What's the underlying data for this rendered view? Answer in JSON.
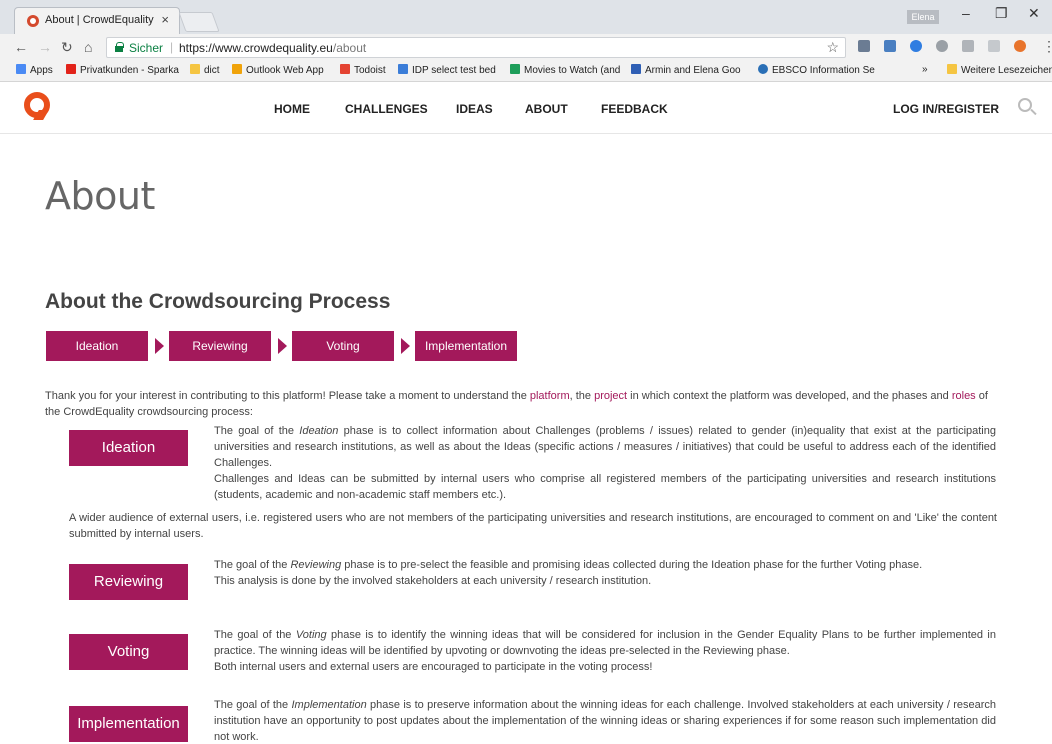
{
  "browser": {
    "tab_title": "About | CrowdEquality",
    "tab_close": "×",
    "profile_label": "Elena",
    "window_controls": [
      "–",
      "❐",
      "✕"
    ],
    "secure_label": "Sicher",
    "url_base": "https://www.crowdequality.eu",
    "url_path": "/about",
    "bookmarks": [
      {
        "label": "Apps",
        "color": "#4a8af4"
      },
      {
        "label": "Privatkunden - Sparka",
        "color": "#e2231a"
      },
      {
        "label": "dict",
        "color": "#f5c542"
      },
      {
        "label": "Outlook Web App",
        "color": "#f0a30a"
      },
      {
        "label": "Todoist",
        "color": "#e44332"
      },
      {
        "label": "IDP select test bed",
        "color": "#3b7dd8"
      },
      {
        "label": "Movies to Watch (and",
        "color": "#1e9e5a"
      },
      {
        "label": "Armin and Elena Goo",
        "color": "#2f5fb5"
      },
      {
        "label": "EBSCO Information Se",
        "color": "#2a6fb6"
      }
    ],
    "bookmarks_overflow": "»",
    "other_bookmarks": "Weitere Lesezeichen"
  },
  "site": {
    "menu": [
      "HOME",
      "CHALLENGES",
      "IDEAS",
      "ABOUT",
      "FEEDBACK"
    ],
    "login": "LOG IN/REGISTER",
    "accent": "#a3195b",
    "logo_color": "#e94e1b"
  },
  "content": {
    "page_title": "About",
    "section_title": "About the Crowdsourcing Process",
    "steps": [
      "Ideation",
      "Reviewing",
      "Voting",
      "Implementation"
    ],
    "intro_1": "Thank you for your interest in contributing to this platform! Please take a moment to understand the ",
    "intro_link_platform": "platform",
    "intro_2": ", the ",
    "intro_link_project": "project",
    "intro_3": " in which context the platform was developed, and the phases and ",
    "intro_link_roles": "roles",
    "intro_4": " of the CrowdEquality crowdsourcing process:",
    "phases": {
      "ideation": {
        "button": "Ideation",
        "p1_a": "The goal of the ",
        "p1_em": "Ideation",
        "p1_b": " phase is to collect information about Challenges (problems / issues) related to gender (in)equality that exist at the participating universities and research institutions, as well as about the Ideas (specific actions / measures / initiatives) that could be useful to address each of the identified Challenges.",
        "p2": "Challenges and Ideas can be submitted by internal users who comprise all registered members of the participating universities and research institutions (students, academic and non-academic staff members etc.).",
        "p3": "A wider audience of external users, i.e. registered users who are not members of the participating universities and research institutions, are encouraged to comment on and 'Like' the content submitted by internal users."
      },
      "reviewing": {
        "button": "Reviewing",
        "p1_a": "The goal of the ",
        "p1_em": "Reviewing",
        "p1_b": " phase is to pre-select the feasible and promising ideas collected during the Ideation phase for the further Voting phase.",
        "p2": "This analysis is done by the involved stakeholders at each university / research institution."
      },
      "voting": {
        "button": "Voting",
        "p1_a": "The goal of the ",
        "p1_em": "Voting",
        "p1_b": " phase is to identify the winning ideas that will be considered for inclusion in the Gender Equality Plans to be further implemented in practice. The winning ideas will be identified by upvoting or downvoting the ideas pre-selected in the Reviewing phase.",
        "p2": "Both internal users and external users are encouraged to participate in the voting process!"
      },
      "implementation": {
        "button": "Implementation",
        "p1_a": "The goal of the ",
        "p1_em": "Implementation",
        "p1_b": " phase is to preserve information about the winning ideas for each challenge. Involved stakeholders at each university / research institution have an opportunity to post updates about the implementation of the winning ideas or sharing experiences if for some reason such implementation did not work."
      }
    }
  }
}
